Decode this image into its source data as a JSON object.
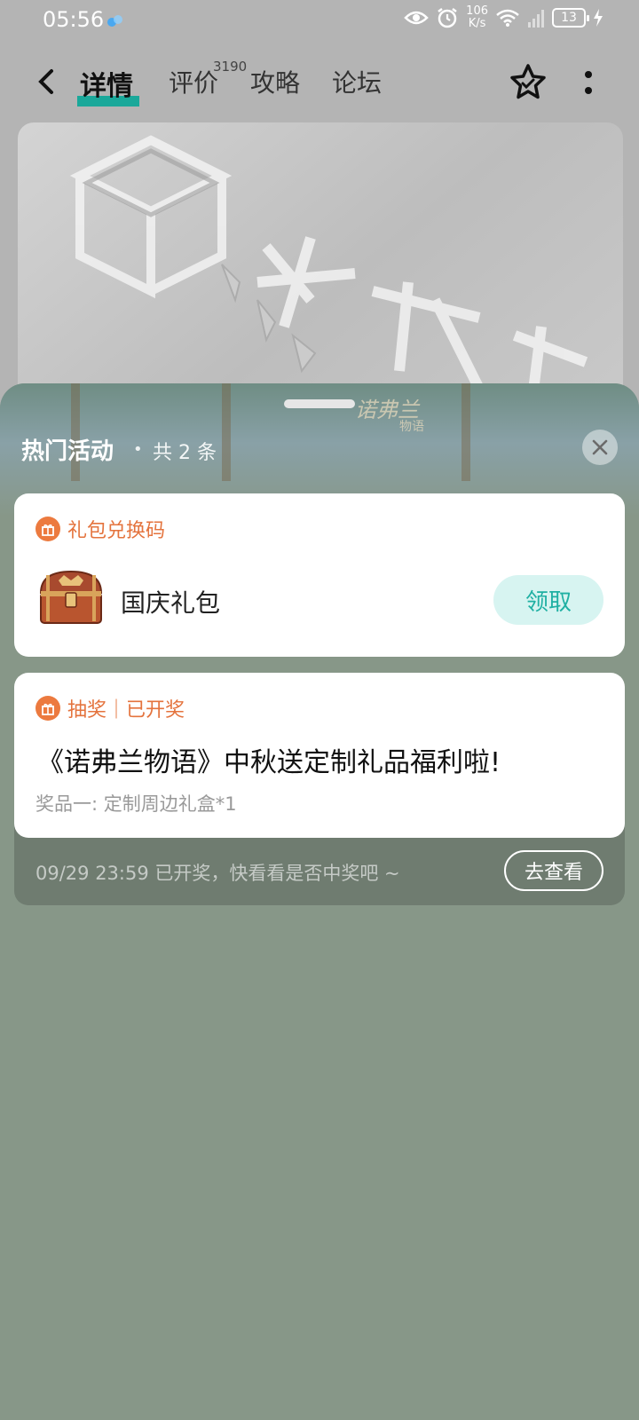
{
  "status_bar": {
    "time": "05:56",
    "net_speed_value": "106",
    "net_speed_unit": "K/s",
    "battery": "13"
  },
  "nav": {
    "tabs": [
      {
        "label": "详情",
        "active": true
      },
      {
        "label": "评价",
        "badge": "3190"
      },
      {
        "label": "攻略"
      },
      {
        "label": "论坛"
      }
    ],
    "accent_color": "#1aa89a"
  },
  "sheet": {
    "title": "热门活动",
    "dot": "•",
    "count_text": "共 2 条",
    "game_logo": "诺弗兰",
    "game_logo_sub": "物语"
  },
  "gift_card": {
    "tag": "礼包兑换码",
    "item_name": "国庆礼包",
    "button": "领取",
    "tag_color": "#e4733d"
  },
  "lottery_card": {
    "tag": "抽奖｜已开奖",
    "title": "《诺弗兰物语》中秋送定制礼品福利啦!",
    "prize": "奖品一:  定制周边礼盒*1",
    "footer": "09/29 23:59 已开奖，快看看是否中奖吧 ~",
    "button": "去查看"
  }
}
